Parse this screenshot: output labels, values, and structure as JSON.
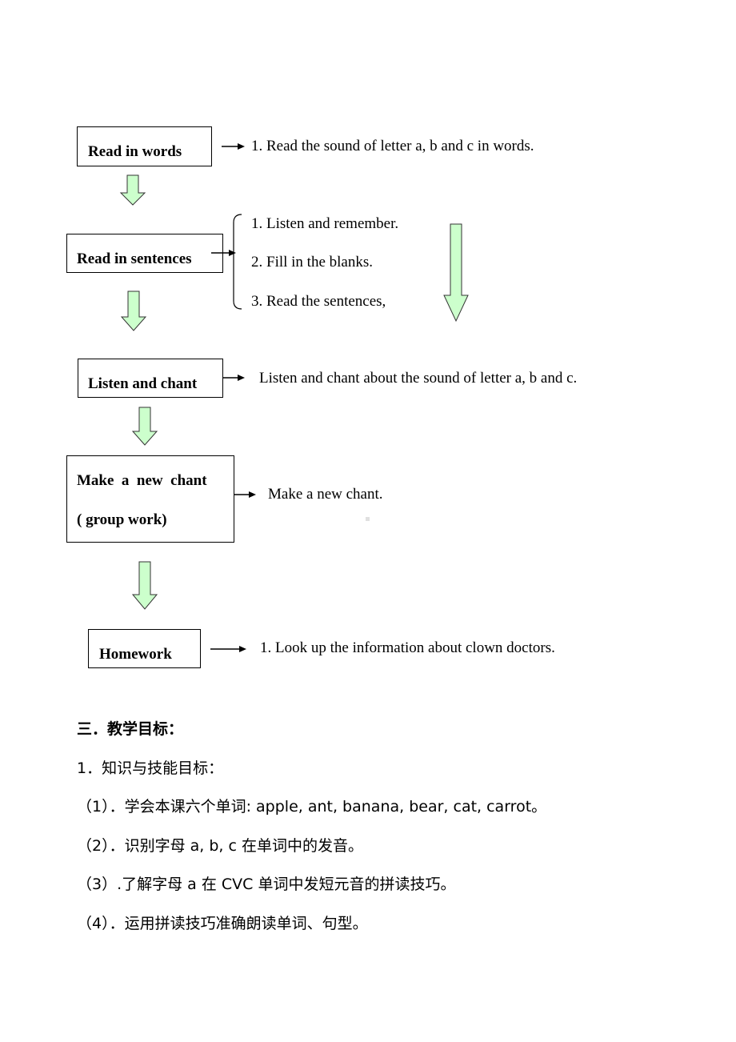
{
  "flowchart": {
    "steps": [
      {
        "label": "Read in words",
        "notes": [
          "1. Read the sound of letter a, b and c in words."
        ]
      },
      {
        "label": "Read in sentences",
        "notes": [
          "1. Listen and remember.",
          "2. Fill in the blanks.",
          "3. Read the sentences,"
        ]
      },
      {
        "label": "Listen and chant",
        "notes": [
          "Listen and chant about the sound of letter a, b and c."
        ]
      },
      {
        "label_line1": "Make  a  new  chant",
        "label_line2": "( group work)",
        "notes": [
          "Make a new chant."
        ]
      },
      {
        "label": "Homework",
        "notes": [
          "1. Look up the information about clown doctors."
        ]
      }
    ],
    "arrow_fill_color": "#ccffcc",
    "arrow_stroke_color": "#333333"
  },
  "objectives": {
    "heading": "三．教学目标：",
    "subheading": "1．知识与技能目标：",
    "items": [
      "（1）．学会本课六个单词: apple, ant, banana, bear, cat, carrot。",
      "（2）．识别字母 a, b, c 在单词中的发音。",
      "（3）.了解字母 a 在 CVC 单词中发短元音的拼读技巧。",
      "（4）．运用拼读技巧准确朗读单词、句型。"
    ]
  }
}
